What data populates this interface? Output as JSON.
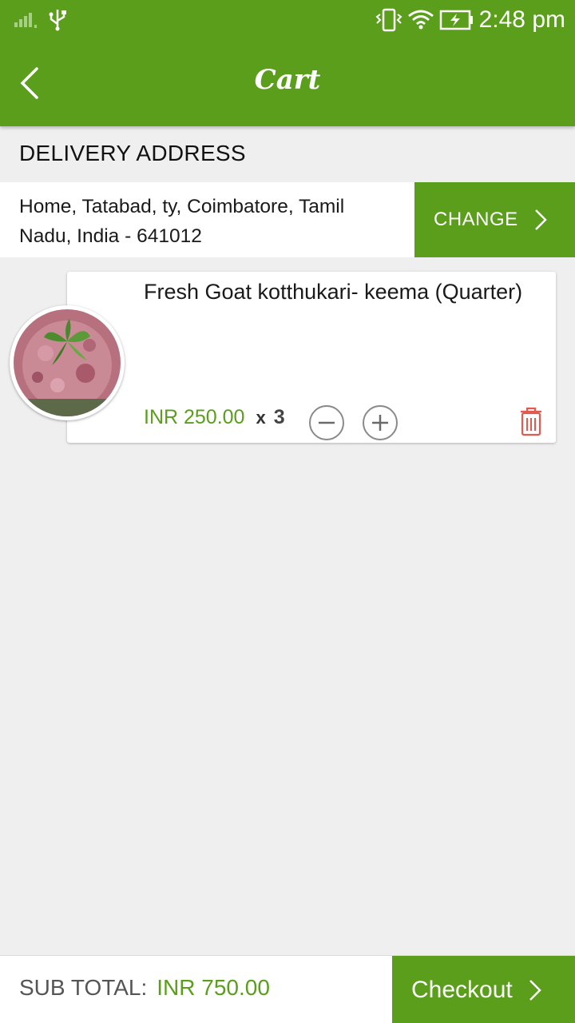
{
  "status_bar": {
    "time": "2:48 pm"
  },
  "app_bar": {
    "title": "Cart"
  },
  "delivery": {
    "section_label": "DELIVERY ADDRESS",
    "address": "Home, Tatabad, ty, Coimbatore, Tamil Nadu, India - 641012",
    "change_label": "CHANGE"
  },
  "cart": {
    "items": [
      {
        "name": "Fresh Goat kotthukari- keema (Quarter)",
        "price": "INR 250.00",
        "multiplier": "x",
        "quantity": "3"
      }
    ]
  },
  "footer": {
    "subtotal_label": "SUB TOTAL:",
    "subtotal_value": "INR 750.00",
    "checkout_label": "Checkout"
  },
  "colors": {
    "accent": "#5a9e1c",
    "delete": "#e05a4f"
  }
}
